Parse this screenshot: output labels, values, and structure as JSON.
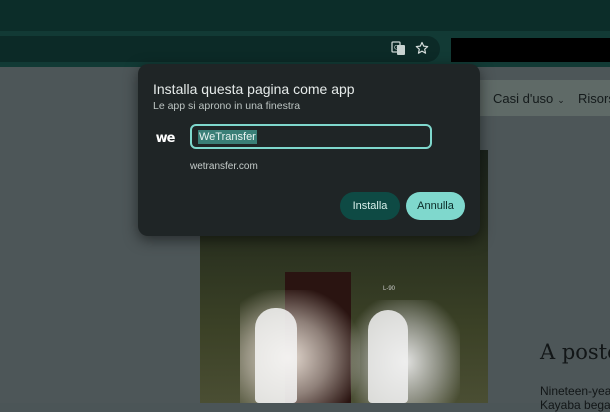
{
  "browser": {
    "translate_icon": "translate-icon",
    "bookmark_icon": "star-icon"
  },
  "site": {
    "nav": [
      {
        "label": "Casi d'uso",
        "has_chevron": true
      },
      {
        "label": "Risors",
        "has_chevron": false
      }
    ],
    "photo_label": "L-90",
    "headline": "A poste",
    "body_line1": "Nineteen-year",
    "body_line2": "Kayaba bega"
  },
  "dialog": {
    "title": "Installa questa pagina come app",
    "subtitle": "Le app si aprono in una finestra",
    "app_logo_text": "we",
    "name_value": "WeTransfer",
    "url": "wetransfer.com",
    "install_label": "Installa",
    "cancel_label": "Annulla"
  },
  "colors": {
    "accent": "#7fd8cd",
    "install_button": "#0e4a44",
    "dialog_bg": "#1f2526",
    "chrome_bg": "#123a35"
  }
}
